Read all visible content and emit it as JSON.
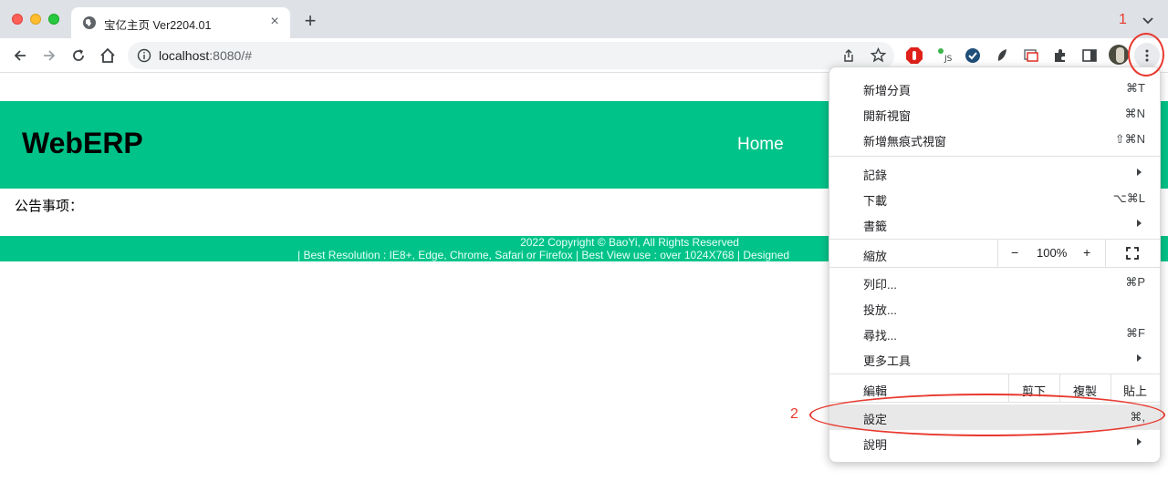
{
  "tab": {
    "title": "宝亿主页 Ver2204.01"
  },
  "address_bar": {
    "host": "localhost",
    "path": ":8080/#"
  },
  "page": {
    "brand": "WebERP",
    "nav_home": "Home",
    "notice_label": "公告事项：",
    "footer_line1": "2022 Copyright © BaoYi, All Rights Reserved",
    "footer_line2": "| Best Resolution : IE8+, Edge, Chrome, Safari or Firefox  |  Best View use : over 1024X768  |  Designed"
  },
  "menu": {
    "items": [
      {
        "label": "新增分頁",
        "shortcut": "⌘T"
      },
      {
        "label": "開新視窗",
        "shortcut": "⌘N"
      },
      {
        "label": "新增無痕式視窗",
        "shortcut": "⇧⌘N"
      },
      {
        "label": "記錄",
        "shortcut": ""
      },
      {
        "label": "下載",
        "shortcut": "⌥⌘L"
      },
      {
        "label": "書籤",
        "shortcut": ""
      },
      {
        "label": "列印...",
        "shortcut": "⌘P"
      },
      {
        "label": "投放...",
        "shortcut": ""
      },
      {
        "label": "尋找...",
        "shortcut": "⌘F"
      },
      {
        "label": "更多工具",
        "shortcut": ""
      },
      {
        "label": "設定",
        "shortcut": "⌘,"
      },
      {
        "label": "說明",
        "shortcut": ""
      }
    ],
    "zoom": {
      "label": "縮放",
      "minus": "−",
      "value": "100%",
      "plus": "+"
    },
    "edit": {
      "label": "編輯",
      "cut": "剪下",
      "copy": "複製",
      "paste": "貼上"
    }
  },
  "annotations": {
    "one": "1",
    "two": "2"
  },
  "colors": {
    "brand_green": "#00c389",
    "annotation_red": "#e8382e"
  }
}
